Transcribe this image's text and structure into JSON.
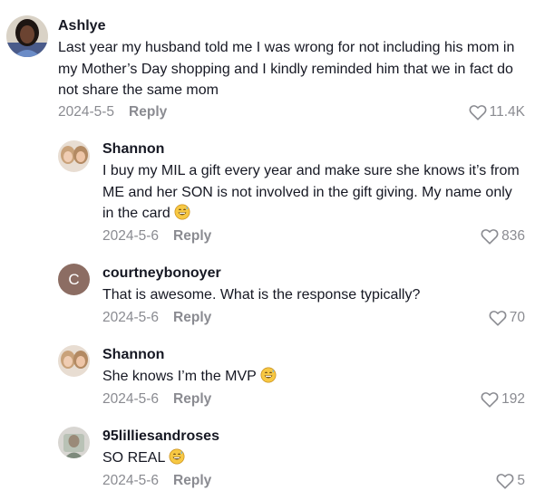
{
  "comments": [
    {
      "username": "Ashlye",
      "text": "Last year my husband told me I was wrong for not including his mom in my Mother’s Day shopping and I kindly reminded him that we in fact do not share the same mom",
      "date": "2024-5-5",
      "reply_label": "Reply",
      "likes": "11.4K",
      "avatar_icon": "profile-photo"
    },
    {
      "username": "Shannon",
      "text": "I buy my MIL a gift every year and make sure she knows it’s from ME and her SON is not involved in the gift giving. My name only in the card",
      "emoji": "grinning-sweat-emoji",
      "date": "2024-5-6",
      "reply_label": "Reply",
      "likes": "836",
      "avatar_icon": "profile-photo"
    },
    {
      "username": "courtneybonoyer",
      "avatar_letter": "C",
      "avatar_color": "#8c6d63",
      "text": "That is awesome. What is the response typically?",
      "date": "2024-5-6",
      "reply_label": "Reply",
      "likes": "70"
    },
    {
      "username": "Shannon",
      "text": "She knows I’m the MVP",
      "emoji": "grinning-sweat-emoji",
      "date": "2024-5-6",
      "reply_label": "Reply",
      "likes": "192",
      "avatar_icon": "profile-photo"
    },
    {
      "username": "95lilliesandroses",
      "text": "SO REAL",
      "emoji": "grinning-sweat-emoji",
      "date": "2024-5-6",
      "reply_label": "Reply",
      "likes": "5",
      "avatar_icon": "profile-photo"
    }
  ],
  "colors": {
    "text": "#161823",
    "muted": "#8a8b91",
    "background": "#ffffff"
  }
}
